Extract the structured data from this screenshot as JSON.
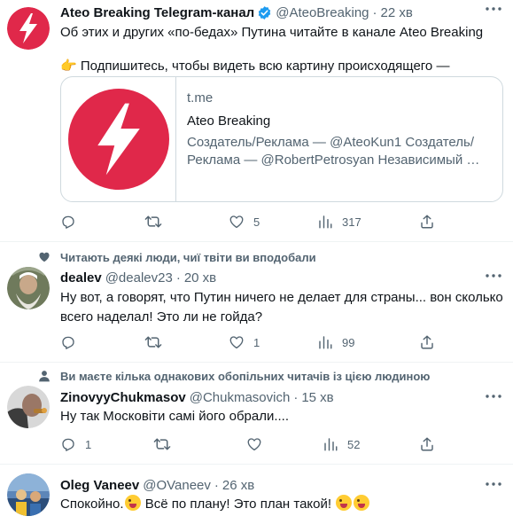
{
  "colors": {
    "brand_red": "#e0284a",
    "verified_blue": "#1d9bf0",
    "secondary_text": "#536471",
    "divider": "#eff3f4"
  },
  "tweets": [
    {
      "name": "Ateo Breaking Telegram-канал",
      "verified": true,
      "handle": "@AteoBreaking",
      "time": "22 хв",
      "text_line1": "Об этих и других «по-бедах» Путина читайте в канале Ateo Breaking",
      "text_line2_emoji": "👉",
      "text_line2": "Подпишитесь, чтобы видеть всю картину происходящего —",
      "card": {
        "domain": "t.me",
        "title": "Ateo Breaking",
        "description": "Создатель/Реклама — @AteoKun1 Создатель/ Реклама — @RobertPetrosyan Независимый …"
      },
      "actions": {
        "reply": "",
        "retweet": "",
        "like": "5",
        "views": "317"
      }
    },
    {
      "social_context": "Читають деякі люди, чиї твіти ви вподобали",
      "name": "dealev",
      "handle": "@dealev23",
      "time": "20 хв",
      "text_line1": "Ну вот, а говорят, что Путин ничего не делает для страны... вон сколько",
      "text_line2": "всего наделал! Это ли не гойда?",
      "actions": {
        "reply": "",
        "retweet": "",
        "like": "1",
        "views": "99"
      }
    },
    {
      "social_context": "Ви маєте кілька однакових обопільних читачів із цією людиною",
      "name": "ZinovyyChukmasov",
      "handle": "@Chukmasovich",
      "time": "15 хв",
      "text_line1": "Ну так Московіти самі його обрали....",
      "actions": {
        "reply": "1",
        "retweet": "",
        "like": "",
        "views": "52"
      }
    },
    {
      "name": "Oleg Vaneev",
      "handle": "@OVaneev",
      "time": "26 хв",
      "text_part1": "Спокойно.",
      "text_part2": "Всё по плану! Это план такой!",
      "emojis": [
        "zany-face",
        "zany-face",
        "party-face"
      ]
    }
  ]
}
